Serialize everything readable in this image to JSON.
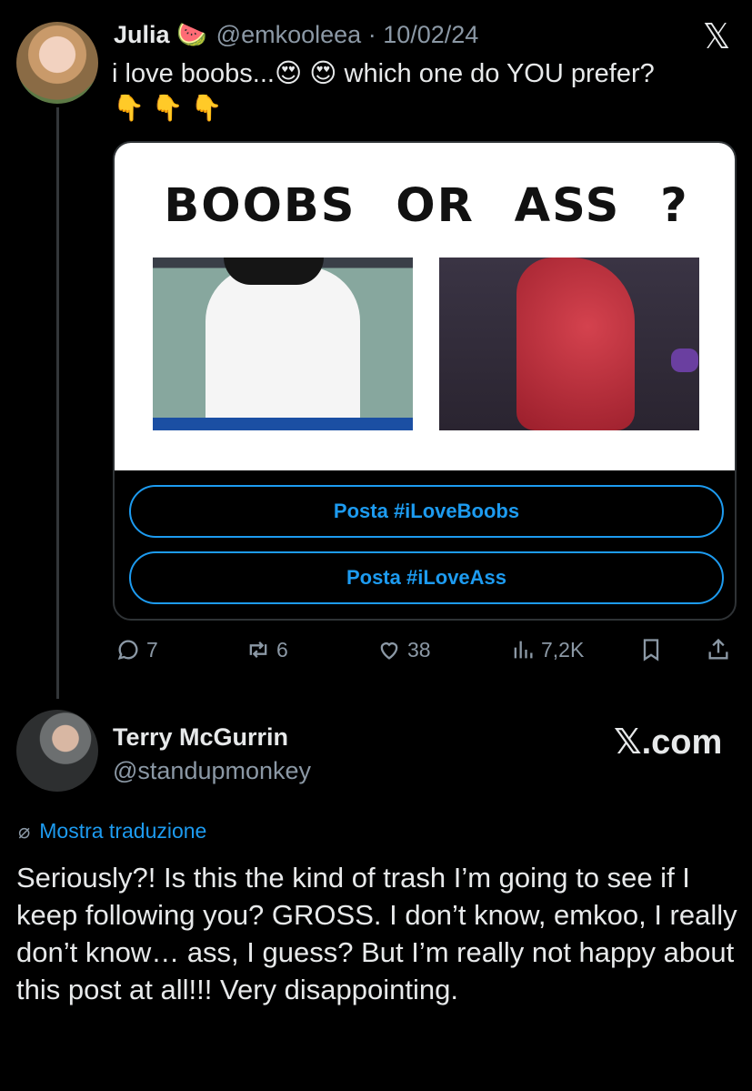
{
  "tweet": {
    "author_name": "Julia",
    "author_emoji": "🍉",
    "handle": "@emkooleea",
    "separator": "·",
    "date": "10/02/24",
    "text": "i love boobs...😍 😍  which one do YOU prefer?",
    "fingers": "👇👇👇",
    "logo_glyph": "𝕏",
    "card": {
      "title": "BOOBS OR ASS ?",
      "poll_options": [
        "Posta #iLoveBoobs",
        "Posta #iLoveAss"
      ]
    },
    "actions": {
      "replies": "7",
      "reposts": "6",
      "likes": "38",
      "views": "7,2K"
    }
  },
  "reply": {
    "author_name": "Terry McGurrin",
    "handle": "@standupmonkey",
    "watermark": "𝕏.com",
    "translate_icon": "⌀",
    "translate_label": "Mostra traduzione",
    "text": "Seriously?! Is this the kind of trash I’m going to see if I keep following you? GROSS. I don’t know, emkoo, I really don’t know… ass, I guess? But I’m really not happy about this post at all!!! Very disappointing."
  },
  "colors": {
    "background": "#000000",
    "text": "#e7e9ea",
    "muted": "#8b98a5",
    "accent": "#1d9bf0"
  }
}
